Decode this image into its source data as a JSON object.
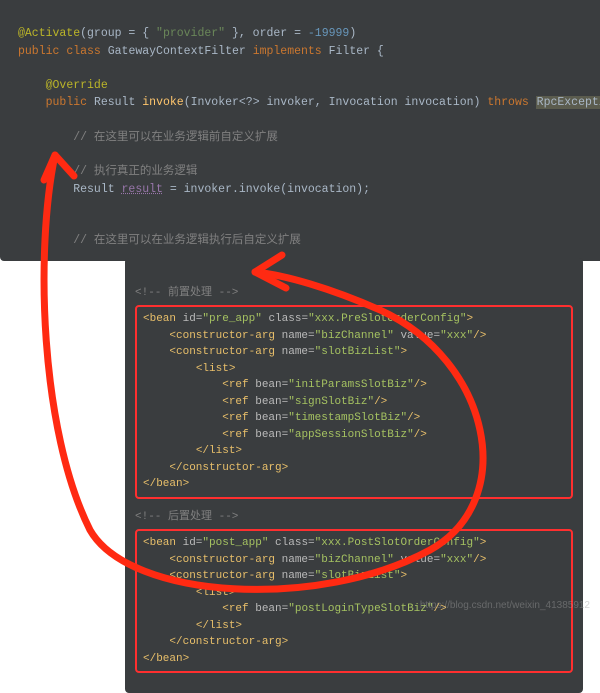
{
  "java": {
    "annotation": "@Activate",
    "annParams": "(group = { \"provider\" }, order = -19999)",
    "modifier1": "public",
    "kwClass": "class",
    "className": "GatewayContextFilter",
    "kwImplements": "implements",
    "iface": "Filter",
    "openBrace": " {",
    "override": "@Override",
    "retType": "Result",
    "method": "invoke",
    "params": "(Invoker<?> invoker, Invocation invocation)",
    "kwThrows": "throws",
    "exc": "RpcException",
    "openBrace2": " {",
    "cm1": "// 在这里可以在业务逻辑前自定义扩展",
    "cm2": "// 执行真正的业务逻辑",
    "stmtLeft": "Result ",
    "stmtVar": "result",
    "stmtRight": " = invoker.invoke(invocation);",
    "cm3": "// 在这里可以在业务逻辑执行后自定义扩展"
  },
  "xml": {
    "cmtPre": "<!-- 前置处理 -->",
    "pre": {
      "beanOpen1": "<bean ",
      "idAttr": "id=",
      "idVal": "\"pre_app\"",
      "classAttr": " class=",
      "classVal": "\"xxx.PreSlotOrderConfig\"",
      "close": ">",
      "ca1Open": "<constructor-arg ",
      "ca1NameAttr": "name=",
      "ca1NameVal": "\"bizChannel\"",
      "ca1ValAttr": " value=",
      "ca1ValVal": "\"xxx\"",
      "ca1Close": "/>",
      "ca2Open": "<constructor-arg ",
      "ca2NameAttr": "name=",
      "ca2NameVal": "\"slotBizList\"",
      "ca2Close": ">",
      "listOpen": "<list>",
      "ref1": "<ref bean=\"initParamsSlotBiz\"/>",
      "ref2": "<ref bean=\"signSlotBiz\"/>",
      "ref3": "<ref bean=\"timestampSlotBiz\"/>",
      "ref4": "<ref bean=\"appSessionSlotBiz\"/>",
      "listClose": "</list>",
      "caClose": "</constructor-arg>",
      "beanClose": "</bean>"
    },
    "cmtPost": "<!-- 后置处理 -->",
    "post": {
      "beanOpen1": "<bean ",
      "idAttr": "id=",
      "idVal": "\"post_app\"",
      "classAttr": " class=",
      "classVal": "\"xxx.PostSlotOrderConfig\"",
      "close": ">",
      "ca1Open": "<constructor-arg ",
      "ca1NameAttr": "name=",
      "ca1NameVal": "\"bizChannel\"",
      "ca1ValAttr": " value=",
      "ca1ValVal": "\"xxx\"",
      "ca1Close": "/>",
      "ca2Open": "<constructor-arg ",
      "ca2NameAttr": "name=",
      "ca2NameVal": "\"slotBizList\"",
      "ca2Close": ">",
      "listOpen": "<list>",
      "ref1": "<ref bean=\"postLoginTypeSlotBiz\"/>",
      "listClose": "</list>",
      "caClose": "</constructor-arg>",
      "beanClose": "</bean>"
    }
  },
  "watermark": "https://blog.csdn.net/weixin_41385912"
}
